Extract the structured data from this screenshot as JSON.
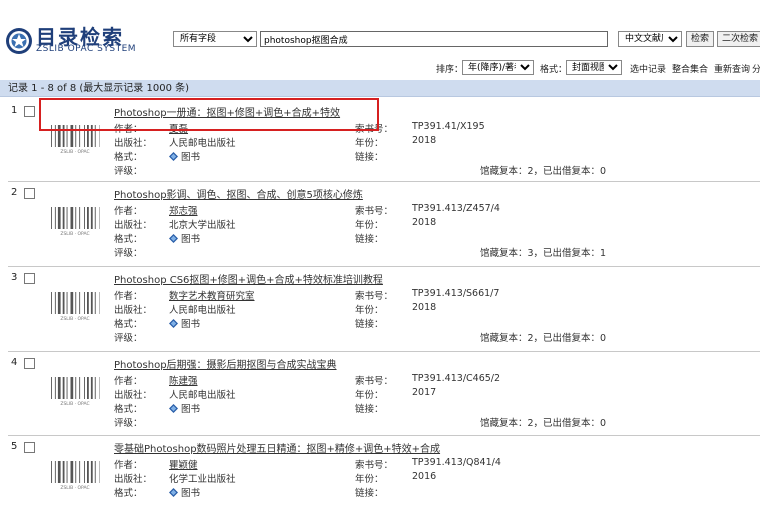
{
  "header": {
    "logo_cn": "目录检索",
    "logo_en": "ZSLIB OPAC SYSTEM",
    "field_select": "所有字段",
    "query": "photoshop抠图合成",
    "db_select": "中文文献库",
    "search_button": "检索",
    "second_search_button": "二次检索"
  },
  "toolbar": {
    "sort_label": "排序：",
    "sort_value": "年(降序)/著者",
    "format_label": "格式：",
    "format_value": "封面视图",
    "selected_records": "选中记录",
    "merge_sets": "整合集合",
    "reset_query": "重新查询",
    "trunc": "分"
  },
  "records_info": "记录 1 - 8 of 8 (最大显示记录 1000 条)",
  "labels": {
    "author": "作者：",
    "publisher": "出版社：",
    "format": "格式：",
    "rating": "评级：",
    "callno": "索书号：",
    "year": "年份：",
    "link": "链接："
  },
  "barcode_text": "ZSLIB · OPAC",
  "colors": {
    "accent": "#1f3f7a",
    "bar": "#cfdcef",
    "highlight": "#d62020"
  },
  "records": [
    {
      "num": "1",
      "title": "Photoshop一册通：抠图+修图+调色+合成+特效",
      "author": "夏磊",
      "publisher": "人民邮电出版社",
      "format": "图书",
      "callno": "TP391.41/X195",
      "year": "2018",
      "holdings": "馆藏复本：2，已出借复本：0"
    },
    {
      "num": "2",
      "title": "Photoshop影调、调色、抠图、合成、创意5项核心修炼",
      "author": "郑志强",
      "publisher": "北京大学出版社",
      "format": "图书",
      "callno": "TP391.413/Z457/4",
      "year": "2018",
      "holdings": "馆藏复本：3，已出借复本：1"
    },
    {
      "num": "3",
      "title": "Photoshop CS6抠图+修图+调色+合成+特效标准培训教程",
      "author": "数字艺术教育研究室",
      "publisher": "人民邮电出版社",
      "format": "图书",
      "callno": "TP391.413/S661/7",
      "year": "2018",
      "holdings": "馆藏复本：2，已出借复本：0"
    },
    {
      "num": "4",
      "title": "Photoshop后期强：摄影后期抠图与合成实战宝典",
      "author": "陈建强",
      "publisher": "人民邮电出版社",
      "format": "图书",
      "callno": "TP391.413/C465/2",
      "year": "2017",
      "holdings": "馆藏复本：2，已出借复本：0"
    },
    {
      "num": "5",
      "title": "零基础Photoshop数码照片处理五日精通：抠图+精修+调色+特效+合成",
      "author": "瞿颖健",
      "publisher": "化学工业出版社",
      "format": "图书",
      "callno": "TP391.413/Q841/4",
      "year": "2016",
      "holdings": ""
    }
  ]
}
